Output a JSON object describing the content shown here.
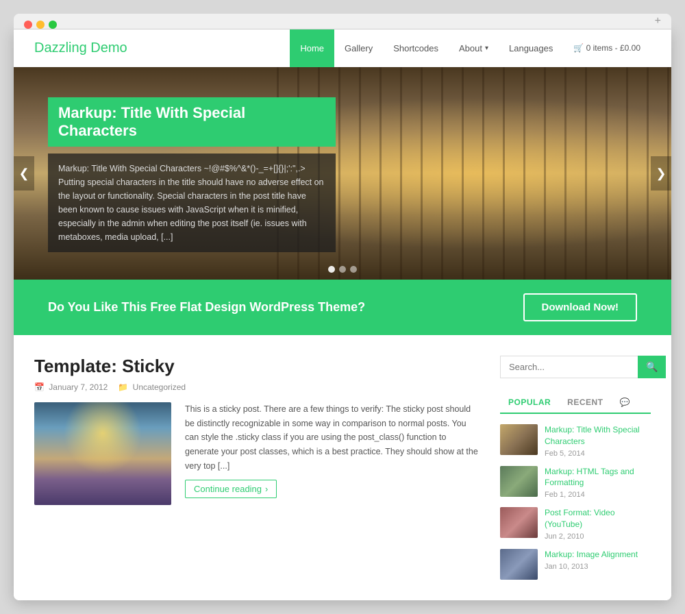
{
  "browser": {
    "plus_label": "+"
  },
  "header": {
    "logo": "Dazzling Demo",
    "nav": [
      {
        "label": "Home",
        "active": true
      },
      {
        "label": "Gallery",
        "active": false
      },
      {
        "label": "Shortcodes",
        "active": false
      },
      {
        "label": "About",
        "active": false,
        "has_caret": true
      },
      {
        "label": "Languages",
        "active": false
      },
      {
        "label": "🛒 0 items - £0.00",
        "active": false
      }
    ]
  },
  "hero": {
    "title": "Markup: Title With Special Characters",
    "excerpt": "Markup: Title With Special Characters ~!@#$%^&*()-_=+[]{}|;':\",.> Putting special characters in the title should have no adverse effect on the layout or functionality. Special characters in the post title have been known to cause issues with JavaScript when it is minified, especially in the admin when editing the post itself (ie. issues with metaboxes, media upload, [...]",
    "arrow_left": "❮",
    "arrow_right": "❯",
    "dots": [
      1,
      2,
      3
    ]
  },
  "cta": {
    "text": "Do You Like This Free Flat Design WordPress Theme?",
    "button": "Download Now!"
  },
  "blog": {
    "post_title": "Template: Sticky",
    "post_date": "January 7, 2012",
    "post_date_icon": "📅",
    "post_category_icon": "📁",
    "post_category": "Uncategorized",
    "post_excerpt": "This is a sticky post. There are a few things to verify: The sticky post should be distinctly recognizable in some way in comparison to normal posts. You can style the .sticky class if you are using the post_class() function to generate your post classes, which is a best practice. They should show at the very top [...]",
    "continue_label": "Continue reading"
  },
  "sidebar": {
    "search_placeholder": "Search...",
    "tabs": [
      {
        "label": "POPULAR",
        "active": true
      },
      {
        "label": "RECENT",
        "active": false
      },
      {
        "label": "💬",
        "active": false
      }
    ],
    "posts": [
      {
        "title": "Markup: Title With Special Characters",
        "date": "Feb 5, 2014",
        "thumb_class": "thumb-1"
      },
      {
        "title": "Markup: HTML Tags and Formatting",
        "date": "Feb 1, 2014",
        "thumb_class": "thumb-2"
      },
      {
        "title": "Post Format: Video (YouTube)",
        "date": "Jun 2, 2010",
        "thumb_class": "thumb-3"
      },
      {
        "title": "Markup: Image Alignment",
        "date": "Jan 10, 2013",
        "thumb_class": "thumb-4"
      }
    ]
  }
}
